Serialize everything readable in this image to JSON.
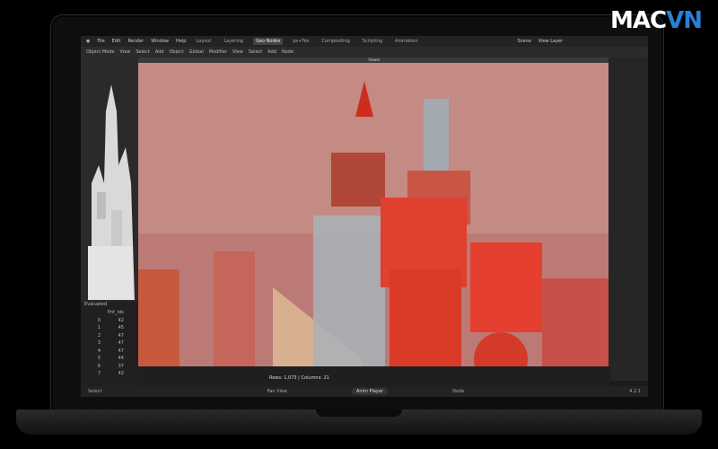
{
  "brand": {
    "logo_left": "MAC",
    "logo_right": "VN"
  },
  "menu": {
    "items": [
      "File",
      "Edit",
      "Render",
      "Window",
      "Help"
    ],
    "tabs": [
      "Layout",
      "Layering",
      "Geo Nodes",
      "ps+Tex",
      "Compositing",
      "Scripting",
      "Animation"
    ],
    "active_tab": "Geo Nodes",
    "scene": "Scene",
    "view_layer": "View Layer"
  },
  "toolbar": {
    "mode": "Object Mode",
    "items": [
      "View",
      "Select",
      "Add",
      "Object"
    ],
    "orientation": "Global",
    "modifier": "Modifier",
    "node_items": [
      "View",
      "Select",
      "Add",
      "Node"
    ]
  },
  "viewport": {
    "header": "Viewer"
  },
  "spreadsheet": {
    "evaluated": "Evaluated",
    "col_header": "Pnt_idx",
    "rows": [
      {
        "i": "0",
        "v": "42"
      },
      {
        "i": "1",
        "v": "45"
      },
      {
        "i": "2",
        "v": "47"
      },
      {
        "i": "3",
        "v": "47"
      },
      {
        "i": "4",
        "v": "47"
      },
      {
        "i": "5",
        "v": "44"
      },
      {
        "i": "6",
        "v": "37"
      },
      {
        "i": "7",
        "v": "42"
      }
    ]
  },
  "footer": {
    "rows_cols": "Rows: 1,073  |  Columns: 21",
    "anim_player": "Anim Player",
    "left": "Select",
    "mid_left": "Pan View",
    "mid": "Node",
    "version": "4.2.1"
  },
  "colors": {
    "viewport_bg": "#c4827d",
    "accent": "#2b7fd4"
  }
}
